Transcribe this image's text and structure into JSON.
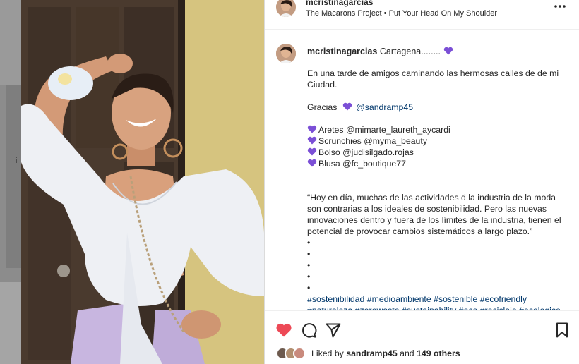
{
  "post": {
    "username": "mcristinagarcias",
    "song": "The Macarons Project • Put Your Head On My Shoulder",
    "more_icon": "more-horizontal-icon"
  },
  "backdrop": {
    "partial_letter": "i"
  },
  "caption": {
    "username": "mcristinagarcias",
    "first_text": "Cartagena........",
    "lines": [
      "En una tarde de amigos caminando las hermosas calles de de mi",
      "Ciudad.",
      "",
      "Gracias",
      "@sandramp45",
      "",
      "Aretes @mimarte_laureth_aycardi",
      "Scrunchies @myma_beauty",
      "Bolso @judisilgado.rojas",
      "Blusa @fc_boutique77",
      "",
      "",
      "“Hoy en día, muchas de las actividades d la industria de la moda",
      "son contrarias a los ideales de sostenibilidad. Pero las nuevas",
      "innovaciones dentro y fuera de los límites de la industria, tienen el",
      "potencial de provocar cambios sistemáticos a largo plazo.”",
      "•",
      "•",
      "•",
      "•",
      "•",
      "#sostenibilidad #medioambiente #sostenible #ecofriendly",
      "#naturaleza #zerowaste #sustainability #eco #reciclaje #ecologico"
    ],
    "heart_icon": "purple-heart-icon",
    "heart_color": "#7b4fd6"
  },
  "actions": {
    "like_icon": "heart-filled-icon",
    "comment_icon": "comment-icon",
    "share_icon": "send-icon",
    "save_icon": "bookmark-icon",
    "like_color": "#ed4956"
  },
  "likes": {
    "prefix": "Liked by",
    "user": "sandramp45",
    "middle": "and",
    "others": "149 others"
  }
}
